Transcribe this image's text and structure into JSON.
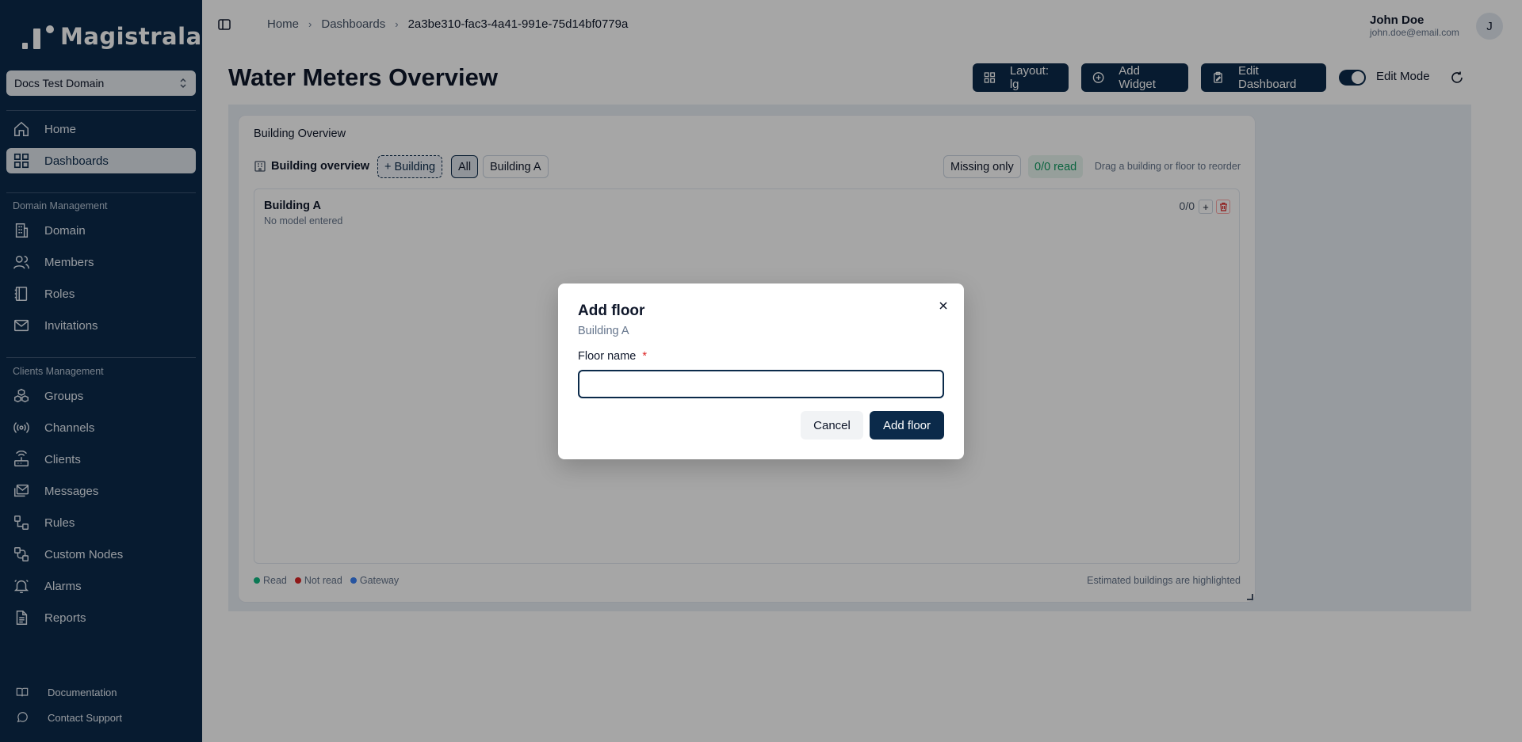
{
  "sidebar": {
    "logo_text": "Magistrala",
    "domain_select": "Docs Test Domain",
    "nav_main": [
      {
        "label": "Home",
        "icon": "home-icon"
      },
      {
        "label": "Dashboards",
        "icon": "dashboard-icon",
        "active": true
      }
    ],
    "section_domain": "Domain Management",
    "nav_domain": [
      {
        "label": "Domain",
        "icon": "building-icon"
      },
      {
        "label": "Members",
        "icon": "users-icon"
      },
      {
        "label": "Roles",
        "icon": "notebook-icon"
      },
      {
        "label": "Invitations",
        "icon": "mail-icon"
      }
    ],
    "section_clients": "Clients Management",
    "nav_clients": [
      {
        "label": "Groups",
        "icon": "groups-icon"
      },
      {
        "label": "Channels",
        "icon": "radio-icon"
      },
      {
        "label": "Clients",
        "icon": "router-icon"
      },
      {
        "label": "Messages",
        "icon": "mails-icon"
      },
      {
        "label": "Rules",
        "icon": "workflow-icon"
      },
      {
        "label": "Custom Nodes",
        "icon": "nodes-icon"
      },
      {
        "label": "Alarms",
        "icon": "bell-icon"
      },
      {
        "label": "Reports",
        "icon": "file-icon"
      }
    ],
    "footer": [
      {
        "label": "Documentation",
        "icon": "book-icon"
      },
      {
        "label": "Contact Support",
        "icon": "chat-icon"
      }
    ]
  },
  "breadcrumb": {
    "items": [
      "Home",
      "Dashboards"
    ],
    "current": "2a3be310-fac3-4a41-991e-75d14bf0779a"
  },
  "user": {
    "name": "John Doe",
    "email": "john.doe@email.com",
    "initial": "J"
  },
  "page": {
    "title": "Water Meters Overview",
    "layout_button": "Layout: lg",
    "add_widget_button": "Add Widget",
    "edit_dashboard_button": "Edit Dashboard",
    "edit_mode_label": "Edit Mode"
  },
  "widget": {
    "title": "Building Overview",
    "toolbar_title": "Building overview",
    "add_building": "+ Building",
    "filter_all": "All",
    "filter_building": "Building A",
    "missing_only": "Missing only",
    "read_count": "0/0 read",
    "hint": "Drag a building or floor to reorder",
    "building": {
      "name": "Building A",
      "model": "No model entered",
      "count": "0/0"
    },
    "legend": [
      {
        "label": "Read",
        "color": "#10b981"
      },
      {
        "label": "Not read",
        "color": "#dc2626"
      },
      {
        "label": "Gateway",
        "color": "#3b82f6"
      }
    ],
    "estimated_note": "Estimated buildings are highlighted"
  },
  "modal": {
    "title": "Add floor",
    "subtitle": "Building A",
    "field_label": "Floor name",
    "required_mark": "*",
    "input_value": "",
    "cancel": "Cancel",
    "submit": "Add floor"
  }
}
